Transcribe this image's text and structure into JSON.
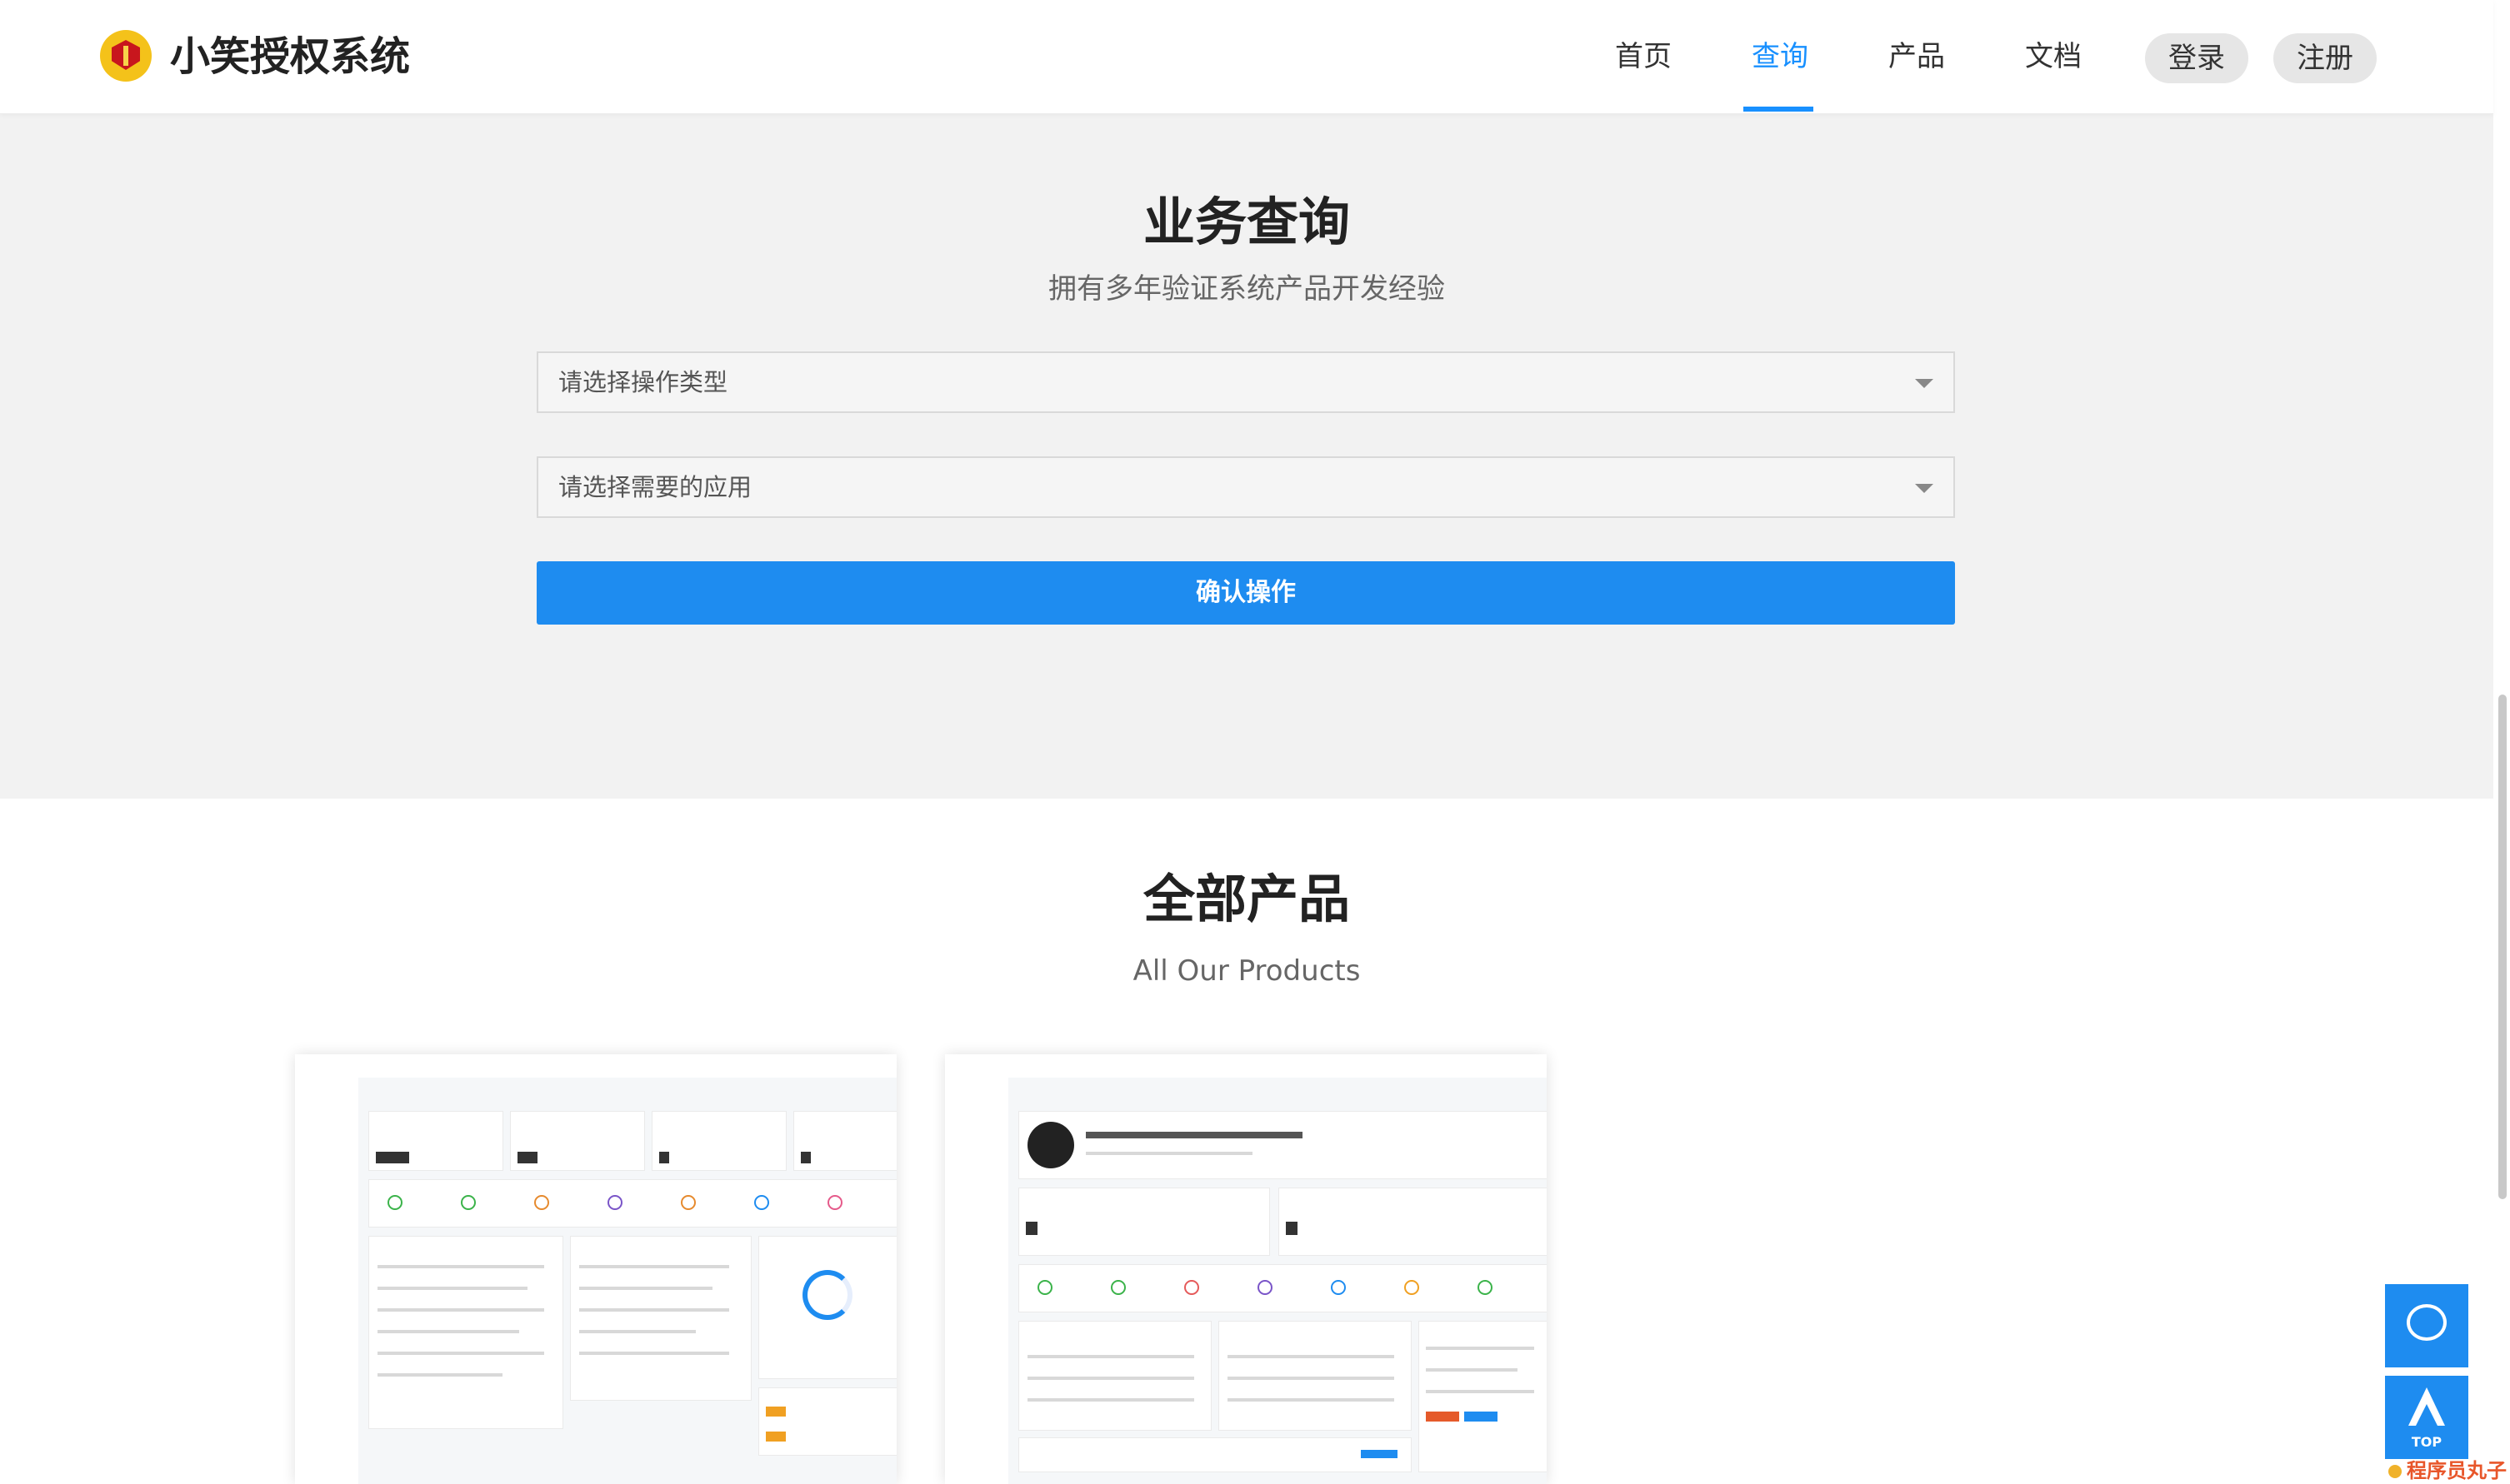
{
  "header": {
    "brand": "小笑授权系统",
    "nav": [
      {
        "label": "首页",
        "active": false
      },
      {
        "label": "查询",
        "active": true
      },
      {
        "label": "产品",
        "active": false
      },
      {
        "label": "文档",
        "active": false
      }
    ],
    "login_label": "登录",
    "register_label": "注册"
  },
  "search": {
    "title": "业务查询",
    "subtitle": "拥有多年验证系统产品开发经验",
    "operation_select": "请选择操作类型",
    "app_select": "请选择需要的应用",
    "confirm_label": "确认操作"
  },
  "products": {
    "title": "全部产品",
    "subtitle": "All Our Products"
  },
  "floating": {
    "chat_icon": "chat-bubble-icon",
    "top_icon": "arrow-up-icon",
    "top_label": "TOP"
  },
  "watermark": "程序员丸子",
  "colors": {
    "accent": "#1890ff",
    "button": "#1e8cf0",
    "search_bg": "#f2f2f2"
  }
}
